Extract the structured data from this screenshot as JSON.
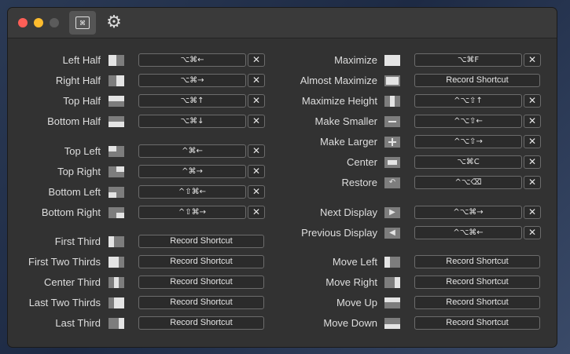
{
  "titlebar": {
    "tabs": [
      {
        "name": "keyboard-shortcuts",
        "glyph": "⌘"
      },
      {
        "name": "preferences",
        "glyph": "⚙"
      }
    ]
  },
  "left": [
    {
      "label": "Left Half",
      "shortcut": "⌥⌘←",
      "icon": "left-half"
    },
    {
      "label": "Right Half",
      "shortcut": "⌥⌘→",
      "icon": "right-half"
    },
    {
      "label": "Top Half",
      "shortcut": "⌥⌘↑",
      "icon": "top-half"
    },
    {
      "label": "Bottom Half",
      "shortcut": "⌥⌘↓",
      "icon": "bottom-half"
    },
    {
      "label": "Top Left",
      "shortcut": "^⌘←",
      "icon": "top-left"
    },
    {
      "label": "Top Right",
      "shortcut": "^⌘→",
      "icon": "top-right"
    },
    {
      "label": "Bottom Left",
      "shortcut": "^⇧⌘←",
      "icon": "bottom-left"
    },
    {
      "label": "Bottom Right",
      "shortcut": "^⇧⌘→",
      "icon": "bottom-right"
    },
    {
      "label": "First Third",
      "shortcut": "Record Shortcut",
      "icon": "first-third"
    },
    {
      "label": "First Two Thirds",
      "shortcut": "Record Shortcut",
      "icon": "first-two-thirds"
    },
    {
      "label": "Center Third",
      "shortcut": "Record Shortcut",
      "icon": "center-third"
    },
    {
      "label": "Last Two Thirds",
      "shortcut": "Record Shortcut",
      "icon": "last-two-thirds"
    },
    {
      "label": "Last Third",
      "shortcut": "Record Shortcut",
      "icon": "last-third"
    }
  ],
  "right": [
    {
      "label": "Maximize",
      "shortcut": "⌥⌘F",
      "icon": "maximize"
    },
    {
      "label": "Almost Maximize",
      "shortcut": "Record Shortcut",
      "icon": "almost-maximize"
    },
    {
      "label": "Maximize Height",
      "shortcut": "^⌥⇧↑",
      "icon": "maximize-height"
    },
    {
      "label": "Make Smaller",
      "shortcut": "^⌥⇧←",
      "icon": "make-smaller"
    },
    {
      "label": "Make Larger",
      "shortcut": "^⌥⇧→",
      "icon": "make-larger"
    },
    {
      "label": "Center",
      "shortcut": "⌥⌘C",
      "icon": "center"
    },
    {
      "label": "Restore",
      "shortcut": "^⌥⌫",
      "icon": "restore"
    },
    {
      "label": "Next Display",
      "shortcut": "^⌥⌘→",
      "icon": "next-display"
    },
    {
      "label": "Previous Display",
      "shortcut": "^⌥⌘←",
      "icon": "previous-display"
    },
    {
      "label": "Move Left",
      "shortcut": "Record Shortcut",
      "icon": "move-left"
    },
    {
      "label": "Move Right",
      "shortcut": "Record Shortcut",
      "icon": "move-right"
    },
    {
      "label": "Move Up",
      "shortcut": "Record Shortcut",
      "icon": "move-up"
    },
    {
      "label": "Move Down",
      "shortcut": "Record Shortcut",
      "icon": "move-down"
    }
  ],
  "clear_glyph": "✕",
  "record_text": "Record Shortcut"
}
